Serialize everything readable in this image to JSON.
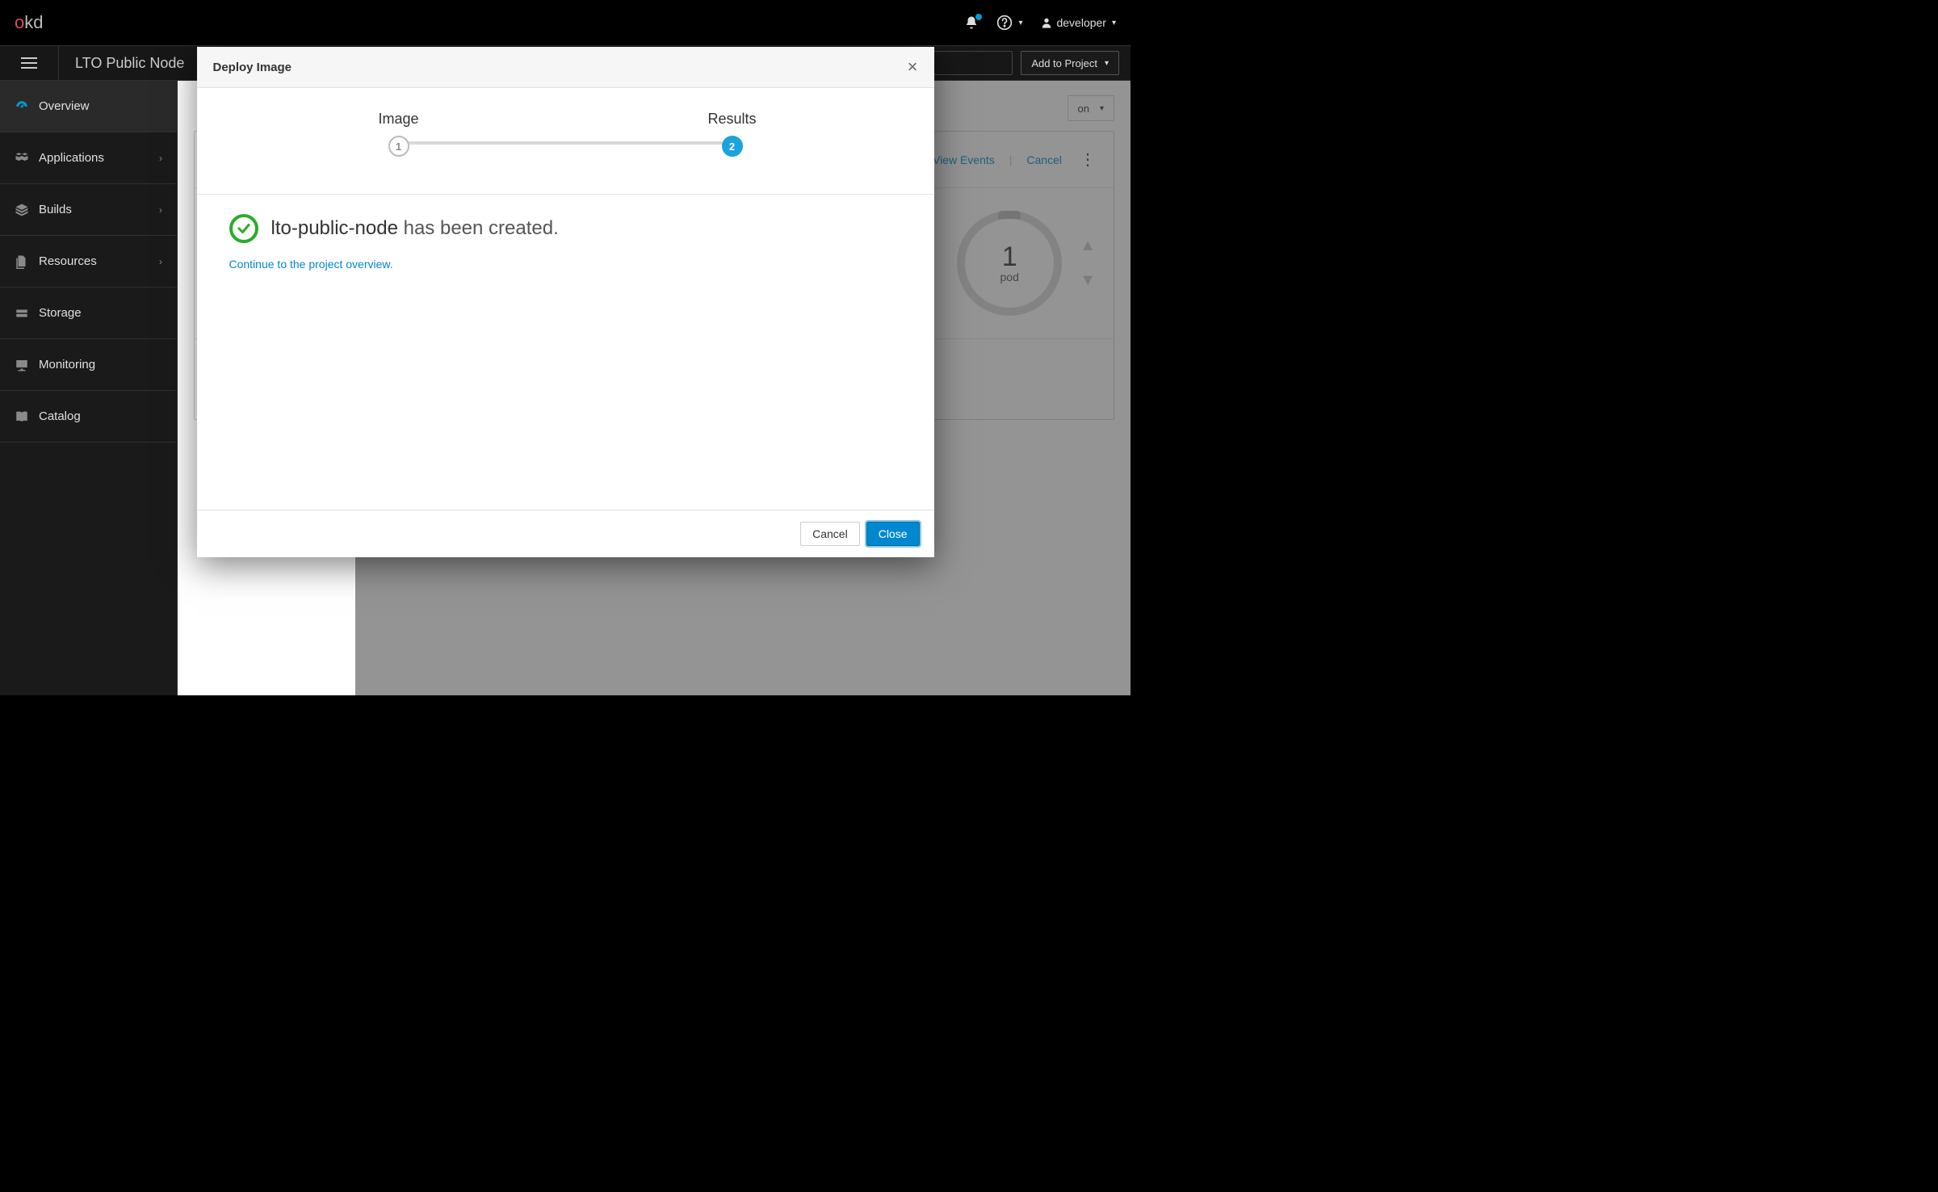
{
  "brand": {
    "o": "o",
    "kd": "kd"
  },
  "topnav": {
    "username": "developer"
  },
  "projectbar": {
    "project_name": "LTO Public Node",
    "add_to_project": "Add to Project"
  },
  "sidebar": {
    "items": [
      {
        "label": "Overview"
      },
      {
        "label": "Applications"
      },
      {
        "label": "Builds"
      },
      {
        "label": "Resources"
      },
      {
        "label": "Storage"
      },
      {
        "label": "Monitoring"
      },
      {
        "label": "Catalog"
      }
    ]
  },
  "main": {
    "list_by_suffix": "on",
    "card": {
      "view_events": "View Events",
      "cancel": "Cancel",
      "pod_count": "1",
      "pod_label": "pod"
    }
  },
  "modal": {
    "title": "Deploy Image",
    "steps": [
      {
        "label": "Image",
        "num": "1"
      },
      {
        "label": "Results",
        "num": "2"
      }
    ],
    "result_name": "lto-public-node",
    "result_suffix": " has been created.",
    "continue_link": "Continue to the project overview.",
    "footer": {
      "cancel": "Cancel",
      "close": "Close"
    }
  }
}
